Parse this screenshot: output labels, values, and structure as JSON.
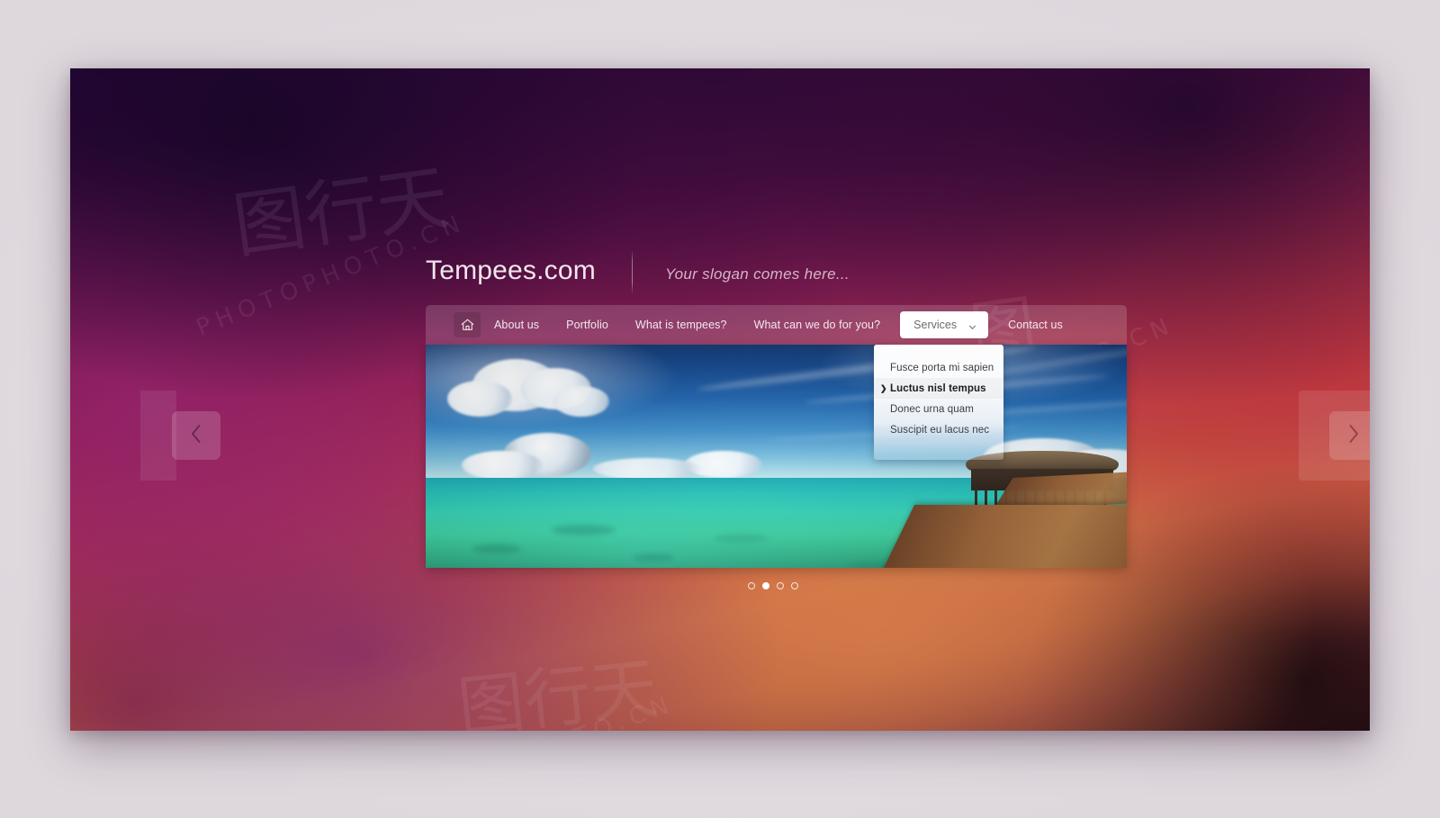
{
  "site": {
    "brand": "Tempees.com",
    "slogan": "Your slogan comes here..."
  },
  "nav": {
    "home_icon": "home-icon",
    "items": [
      {
        "label": "About us"
      },
      {
        "label": "Portfolio"
      },
      {
        "label": "What is tempees?"
      },
      {
        "label": "What can we do for you?"
      }
    ],
    "dropdown": {
      "label": "Services",
      "caret_icon": "chevron-down-icon",
      "items": [
        {
          "label": "Fusce porta mi sapien",
          "active": false
        },
        {
          "label": "Luctus nisl tempus",
          "active": true
        },
        {
          "label": "Donec urna quam",
          "active": false
        },
        {
          "label": "Suscipit eu lacus nec",
          "active": false
        }
      ]
    },
    "contact": {
      "label": "Contact us"
    }
  },
  "slider": {
    "prev_icon": "chevron-left-icon",
    "next_icon": "chevron-right-icon",
    "slide_alt": "Tropical lagoon with wooden pier and overwater bungalow",
    "dots": [
      {
        "active": false
      },
      {
        "active": true
      },
      {
        "active": false
      },
      {
        "active": false
      }
    ]
  },
  "watermarks": {
    "mark_a": "图行天",
    "mark_b": "PHOTOPHOTO.CN",
    "mark_c": "图行天",
    "mark_d": "PHOTOPHOTO.CN",
    "mark_e": "PHOTO.CN",
    "mark_f": "图"
  },
  "colors": {
    "accent_magenta": "#8e1f55",
    "accent_orange": "#cd7244",
    "deep_purple": "#24063a",
    "nav_surface": "rgba(255,255,255,0.165)",
    "dropdown_surface": "#ffffff",
    "page_backdrop": "#e6e1e5"
  }
}
